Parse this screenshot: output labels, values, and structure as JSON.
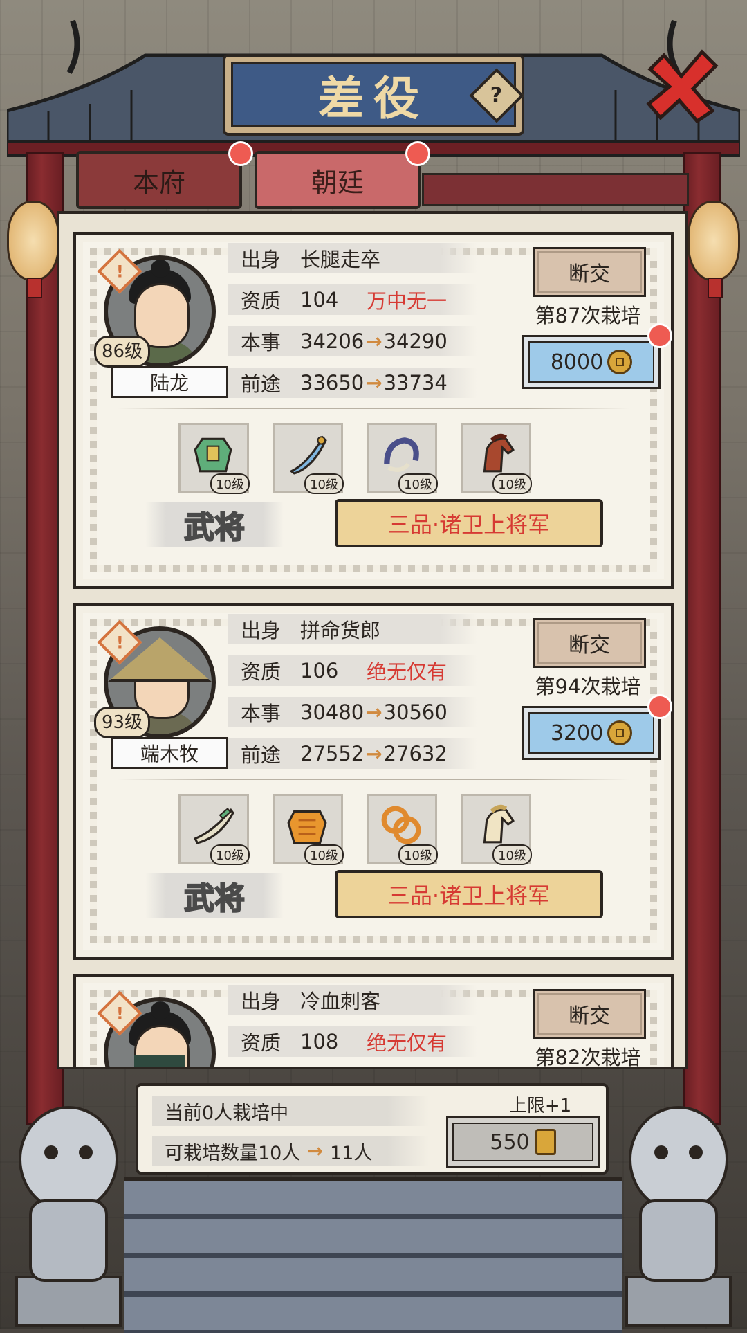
{
  "title": "差役",
  "help_symbol": "?",
  "tabs": [
    {
      "label": "本府",
      "active": false
    },
    {
      "label": "朝廷",
      "active": true
    }
  ],
  "cards": [
    {
      "level": "86级",
      "name": "陆龙",
      "origin_label": "出身",
      "origin": "长腿走卒",
      "aptitude_label": "资质",
      "aptitude": "104",
      "aptitude_tier": "万中无一",
      "skill_label": "本事",
      "skill_from": "34206",
      "skill_to": "34290",
      "prospect_label": "前途",
      "prospect_from": "33650",
      "prospect_to": "33734",
      "cut_label": "断交",
      "cultivation": "第87次栽培",
      "cost": "8000",
      "equipment": [
        {
          "icon": "armor-icon",
          "level": "10级"
        },
        {
          "icon": "sword-icon",
          "level": "10级"
        },
        {
          "icon": "bracelet-icon",
          "level": "10级"
        },
        {
          "icon": "horse-icon",
          "level": "10级"
        }
      ],
      "role": "武将",
      "rank": "三品·诸卫上将军",
      "avatar": "topknot"
    },
    {
      "level": "93级",
      "name": "端木牧",
      "origin_label": "出身",
      "origin": "拼命货郎",
      "aptitude_label": "资质",
      "aptitude": "106",
      "aptitude_tier": "绝无仅有",
      "skill_label": "本事",
      "skill_from": "30480",
      "skill_to": "30560",
      "prospect_label": "前途",
      "prospect_from": "27552",
      "prospect_to": "27632",
      "cut_label": "断交",
      "cultivation": "第94次栽培",
      "cost": "3200",
      "equipment": [
        {
          "icon": "blade-icon",
          "level": "10级"
        },
        {
          "icon": "gold-armor-icon",
          "level": "10级"
        },
        {
          "icon": "rings-icon",
          "level": "10级"
        },
        {
          "icon": "white-horse-icon",
          "level": "10级"
        }
      ],
      "role": "武将",
      "rank": "三品·诸卫上将军",
      "avatar": "hat"
    },
    {
      "origin_label": "出身",
      "origin": "冷血刺客",
      "aptitude_label": "资质",
      "aptitude": "108",
      "aptitude_tier": "绝无仅有",
      "cut_label": "断交",
      "cultivation": "第82次栽培",
      "avatar": "mask"
    }
  ],
  "bottom": {
    "current": "当前0人栽培中",
    "capacity_label": "可栽培数量10人",
    "capacity_next": "11人",
    "limit_label": "上限+1",
    "limit_cost": "550"
  },
  "colors": {
    "tier_red": "#d63a33",
    "cost_blue": "#9ecae9",
    "title_blue": "#3e5a86",
    "pillar_red": "#8a2c30"
  }
}
